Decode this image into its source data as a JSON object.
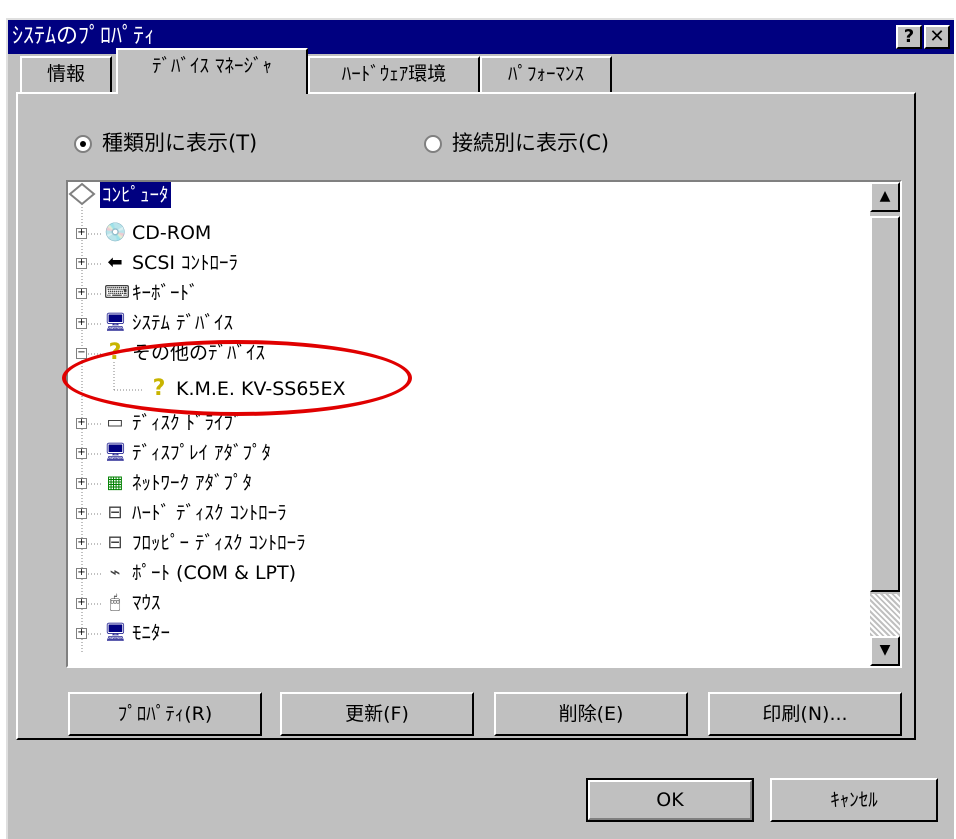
{
  "window": {
    "title": "ｼｽﾃﾑのﾌﾟﾛﾊﾟﾃｨ",
    "help_btn": "?",
    "close_btn": "✕"
  },
  "tabs": [
    {
      "label": "情報"
    },
    {
      "label": "ﾃﾞﾊﾞｲｽ ﾏﾈｰｼﾞｬ"
    },
    {
      "label": "ﾊｰﾄﾞｳｪｱ環境"
    },
    {
      "label": "ﾊﾟﾌｫｰﾏﾝｽ"
    }
  ],
  "view": {
    "by_type": "種類別に表示(T)",
    "by_connection": "接続別に表示(C)"
  },
  "tree": {
    "root": "ｺﾝﾋﾟｭｰﾀ",
    "items": [
      {
        "label": "CD-ROM",
        "icon": "cdrom-icon"
      },
      {
        "label": "SCSI ｺﾝﾄﾛｰﾗ",
        "icon": "scsi-icon"
      },
      {
        "label": "ｷｰﾎﾞｰﾄﾞ",
        "icon": "keyboard-icon"
      },
      {
        "label": "ｼｽﾃﾑ ﾃﾞﾊﾞｲｽ",
        "icon": "computer-icon"
      },
      {
        "label": "その他のﾃﾞﾊﾞｲｽ",
        "icon": "question-icon"
      },
      {
        "label": "K.M.E. KV-SS65EX",
        "icon": "question-warning-icon"
      },
      {
        "label": "ﾃﾞｨｽｸ ﾄﾞﾗｲﾌﾞ",
        "icon": "disk-drive-icon"
      },
      {
        "label": "ﾃﾞｨｽﾌﾟﾚｲ ｱﾀﾞﾌﾟﾀ",
        "icon": "monitor-icon"
      },
      {
        "label": "ﾈｯﾄﾜｰｸ ｱﾀﾞﾌﾟﾀ",
        "icon": "network-card-icon"
      },
      {
        "label": "ﾊｰﾄﾞ ﾃﾞｨｽｸ ｺﾝﾄﾛｰﾗ",
        "icon": "hdd-controller-icon"
      },
      {
        "label": "ﾌﾛｯﾋﾟｰ ﾃﾞｨｽｸ ｺﾝﾄﾛｰﾗ",
        "icon": "floppy-controller-icon"
      },
      {
        "label": "ﾎﾟｰﾄ (COM & LPT)",
        "icon": "port-icon"
      },
      {
        "label": "ﾏｳｽ",
        "icon": "mouse-icon"
      },
      {
        "label": "ﾓﾆﾀｰ",
        "icon": "monitor-icon"
      }
    ]
  },
  "buttons": {
    "properties": "ﾌﾟﾛﾊﾟﾃｨ(R)",
    "refresh": "更新(F)",
    "remove": "削除(E)",
    "print": "印刷(N)...",
    "ok": "OK",
    "cancel": "ｷｬﾝｾﾙ"
  }
}
